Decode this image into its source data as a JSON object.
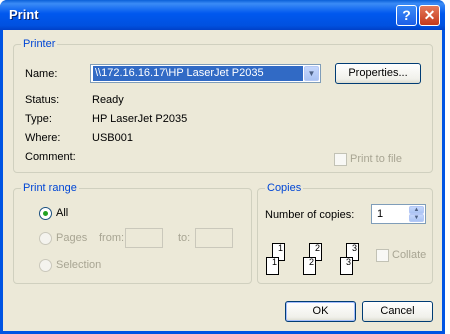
{
  "window": {
    "title": "Print",
    "help_glyph": "?",
    "close_glyph": "✕"
  },
  "printer": {
    "legend": "Printer",
    "name_label": "Name:",
    "name_value": "\\\\172.16.16.17\\HP LaserJet P2035",
    "properties_label": "Properties...",
    "status_label": "Status:",
    "status_value": "Ready",
    "type_label": "Type:",
    "type_value": "HP LaserJet P2035",
    "where_label": "Where:",
    "where_value": "USB001",
    "comment_label": "Comment:",
    "print_to_file_label": "Print to file",
    "print_to_file_checked": false
  },
  "print_range": {
    "legend": "Print range",
    "all_label": "All",
    "pages_label": "Pages",
    "from_label": "from:",
    "to_label": "to:",
    "from_value": "",
    "to_value": "",
    "selection_label": "Selection",
    "selected": "All"
  },
  "copies": {
    "legend": "Copies",
    "number_label": "Number of copies:",
    "number_value": "1",
    "collate_label": "Collate",
    "collate_checked": false,
    "collate_pages": [
      "1",
      "1",
      "2",
      "2",
      "3",
      "3"
    ]
  },
  "buttons": {
    "ok_label": "OK",
    "cancel_label": "Cancel"
  },
  "icons": {
    "dropdown": "chevron-down-icon",
    "spin_up": "spin-up-icon",
    "spin_down": "spin-down-icon"
  }
}
